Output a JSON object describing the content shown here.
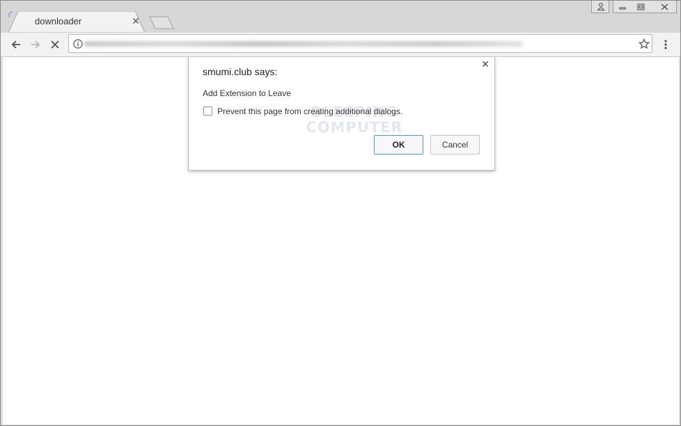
{
  "tab": {
    "title": "downloader",
    "close_label": "✕"
  },
  "dialog": {
    "title": "smumi.club says:",
    "message": "Add Extension to Leave",
    "checkbox_label": "Prevent this page from creating additional dialogs.",
    "ok_label": "OK",
    "cancel_label": "Cancel",
    "close_label": "✕",
    "watermark_line1": "BLEEPING",
    "watermark_line2": "COMPUTER"
  },
  "icons": {
    "back": "back-arrow-icon",
    "forward": "forward-arrow-icon",
    "stop": "stop-icon",
    "info": "info-icon",
    "bookmark": "star-icon",
    "menu": "kebab-menu-icon",
    "user": "user-icon",
    "minimize": "minimize-icon",
    "restore": "restore-icon",
    "close": "close-icon"
  },
  "colors": {
    "titlebar": "#d7d7d7",
    "toolbar": "#f2f2f2",
    "ok_border": "#4d90fe"
  }
}
